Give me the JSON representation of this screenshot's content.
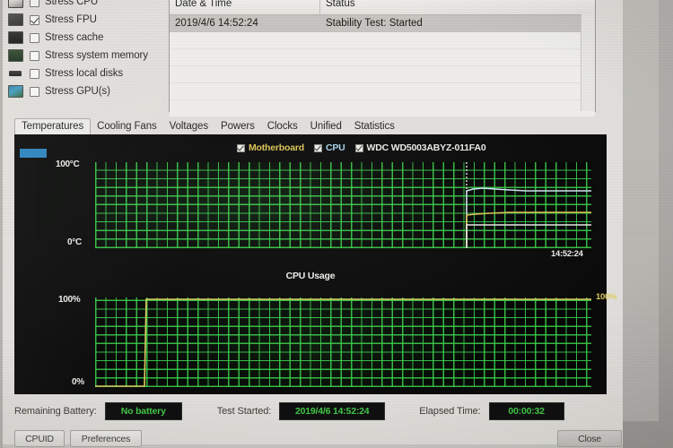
{
  "options": {
    "items": [
      {
        "label": "Stress CPU",
        "checked": false,
        "icon": "cpu-icon"
      },
      {
        "label": "Stress FPU",
        "checked": true,
        "icon": "fpu-icon"
      },
      {
        "label": "Stress cache",
        "checked": false,
        "icon": "cache-icon"
      },
      {
        "label": "Stress system memory",
        "checked": false,
        "icon": "memory-icon"
      },
      {
        "label": "Stress local disks",
        "checked": false,
        "icon": "disk-icon"
      },
      {
        "label": "Stress GPU(s)",
        "checked": false,
        "icon": "gpu-icon"
      }
    ]
  },
  "log": {
    "columns": [
      "Date & Time",
      "Status"
    ],
    "rows": [
      {
        "datetime": "2019/4/6 14:52:24",
        "status": "Stability Test: Started"
      }
    ]
  },
  "tabs": [
    {
      "label": "Temperatures",
      "active": true
    },
    {
      "label": "Cooling Fans",
      "active": false
    },
    {
      "label": "Voltages",
      "active": false
    },
    {
      "label": "Powers",
      "active": false
    },
    {
      "label": "Clocks",
      "active": false
    },
    {
      "label": "Unified",
      "active": false
    },
    {
      "label": "Statistics",
      "active": false
    }
  ],
  "legend": [
    {
      "label": "Motherboard",
      "checked": true,
      "color": "#e2c84a"
    },
    {
      "label": "CPU",
      "checked": true,
      "color": "#a6d8ee"
    },
    {
      "label": "WDC WD5003ABYZ-011FA0",
      "checked": true,
      "color": "#eeeeea"
    }
  ],
  "temp_chart": {
    "ymax_label": "100°C",
    "ymin_label": "0°C",
    "time_label": "14:52:24",
    "value_cpu": "66",
    "value_motherboard": "42",
    "value_hdd": "27"
  },
  "usage_chart": {
    "title": "CPU Usage",
    "ymax_label": "100%",
    "ymin_label": "0%",
    "value_label": "100%"
  },
  "status": {
    "battery_label": "Remaining Battery:",
    "battery_value": "No battery",
    "started_label": "Test Started:",
    "started_value": "2019/4/6 14:52:24",
    "elapsed_label": "Elapsed Time:",
    "elapsed_value": "00:00:32"
  },
  "buttons": {
    "cpuid": "CPUID",
    "preferences": "Preferences",
    "close": "Close"
  },
  "chart_data": [
    {
      "type": "line",
      "title": "Temperatures",
      "xlabel": "",
      "ylabel": "°C",
      "ylim": [
        0,
        100
      ],
      "x_tick_labels": [
        "14:52:24"
      ],
      "grid": true,
      "legend_position": "top",
      "series": [
        {
          "name": "CPU",
          "color": "#cfe9f6",
          "end_value": 66,
          "values": [
            null,
            null,
            null,
            66,
            69,
            68,
            67,
            66,
            66,
            66
          ]
        },
        {
          "name": "Motherboard",
          "color": "#e2c84a",
          "end_value": 42,
          "values": [
            null,
            null,
            null,
            40,
            41,
            41,
            42,
            42,
            42,
            42
          ]
        },
        {
          "name": "WDC WD5003ABYZ-011FA0",
          "color": "#f2f2ee",
          "end_value": 27,
          "values": [
            null,
            null,
            null,
            27,
            27,
            27,
            27,
            27,
            27,
            27
          ]
        }
      ]
    },
    {
      "type": "line",
      "title": "CPU Usage",
      "xlabel": "",
      "ylabel": "%",
      "ylim": [
        0,
        100
      ],
      "grid": true,
      "legend_position": "none",
      "series": [
        {
          "name": "CPU Usage",
          "color": "#e6d155",
          "end_value": 100,
          "values": [
            0,
            0,
            0,
            0,
            100,
            100,
            100,
            100,
            100,
            100,
            100,
            100
          ]
        }
      ]
    }
  ]
}
